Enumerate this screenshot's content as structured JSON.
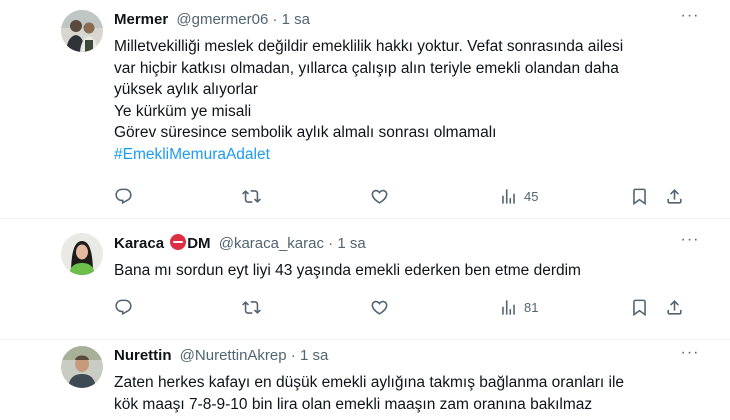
{
  "tweets": [
    {
      "name": "Mermer",
      "handle": "@gmermer06",
      "time": "1 sa",
      "lines": [
        "Milletvekilliği meslek değildir emeklilik hakkı yoktur. Vefat sonrasında ailesi",
        "var hiçbir katkısı olmadan, yıllarca çalışıp alın teriyle emekli olandan  daha",
        "yüksek aylık alıyorlar",
        "Ye kürküm ye misali",
        "Görev süresince sembolik aylık almalı sonrası olmamalı"
      ],
      "hashtag": "#EmekliMemuraAdalet",
      "views": "45"
    },
    {
      "name": "Karaca",
      "name_suffix": "DM",
      "handle": "@karaca_karac",
      "time": "1 sa",
      "lines": [
        "Bana mı sordun eyt liyi 43 yaşında emekli ederken ben etme derdim"
      ],
      "views": "81"
    },
    {
      "name": "Nurettin",
      "handle": "@NurettinAkrep",
      "time": "1 sa",
      "lines": [
        "Zaten herkes kafayı en düşük emekli aylığına takmış bağlanma oranları ile",
        "kök maaşı 7-8-9-10 bin lira olan emekli maaşın zam oranına bakılmaz"
      ]
    }
  ],
  "separator": "·",
  "more_glyph": "···",
  "colors": {
    "text": "#0f1419",
    "secondary": "#536471",
    "link": "#1d9bf0",
    "divider": "#eff3f4",
    "no_entry_red": "#dd2e44"
  },
  "icons": [
    "reply-icon",
    "retweet-icon",
    "like-icon",
    "views-icon",
    "bookmark-icon",
    "share-icon",
    "more-icon",
    "no-entry-icon"
  ]
}
